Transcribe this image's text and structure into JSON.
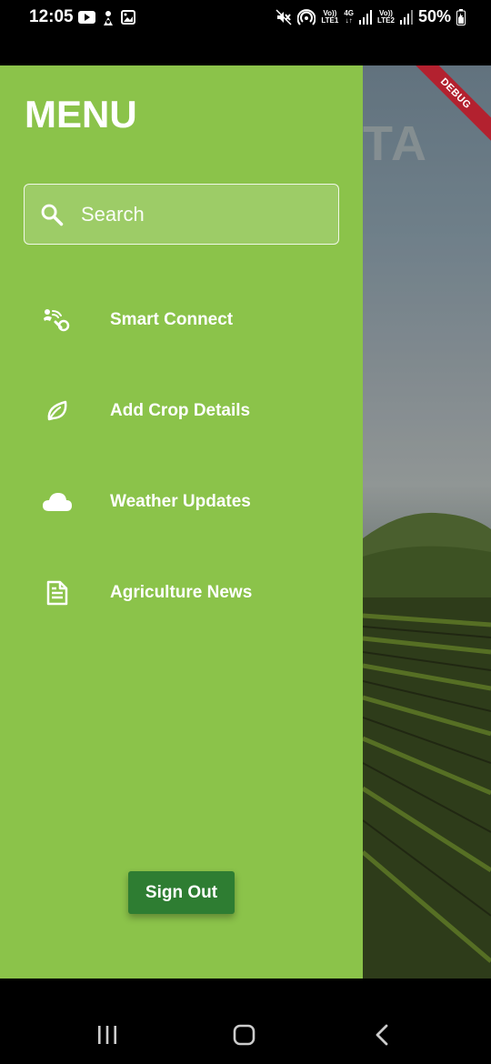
{
  "status_bar": {
    "time": "12:05",
    "battery": "50%",
    "left_icons": [
      "youtube-icon",
      "notification-icon",
      "gallery-icon"
    ],
    "right_icons": [
      "mute-icon",
      "hotspot-icon",
      "lte1-icon",
      "4g-icon",
      "signal-icon",
      "lte2-icon",
      "signal-icon",
      "battery-icon"
    ],
    "net_labels": {
      "lte1_top": "Vo))",
      "lte1_bottom": "LTE1",
      "g4_top": "4G",
      "g4_bottom": "↓↑",
      "lte2_top": "Vo))",
      "lte2_bottom": "LTE2"
    }
  },
  "background_app": {
    "title_fragment": "TA",
    "debug_label": "DEBUG"
  },
  "drawer": {
    "title": "MENU",
    "search": {
      "placeholder": "Search",
      "value": "",
      "icon": "search-icon"
    },
    "items": [
      {
        "label": "Smart Connect",
        "icon": "smart-connect-icon"
      },
      {
        "label": "Add Crop Details",
        "icon": "leaf-icon"
      },
      {
        "label": "Weather Updates",
        "icon": "cloud-icon"
      },
      {
        "label": "Agriculture News",
        "icon": "news-icon"
      }
    ],
    "sign_out_label": "Sign Out",
    "colors": {
      "drawer_bg": "#8bc34a",
      "button_bg": "#2e7d32",
      "debug_banner": "#b3212f"
    }
  },
  "nav_bar": {
    "buttons": [
      "recents-icon",
      "home-icon",
      "back-icon"
    ]
  }
}
